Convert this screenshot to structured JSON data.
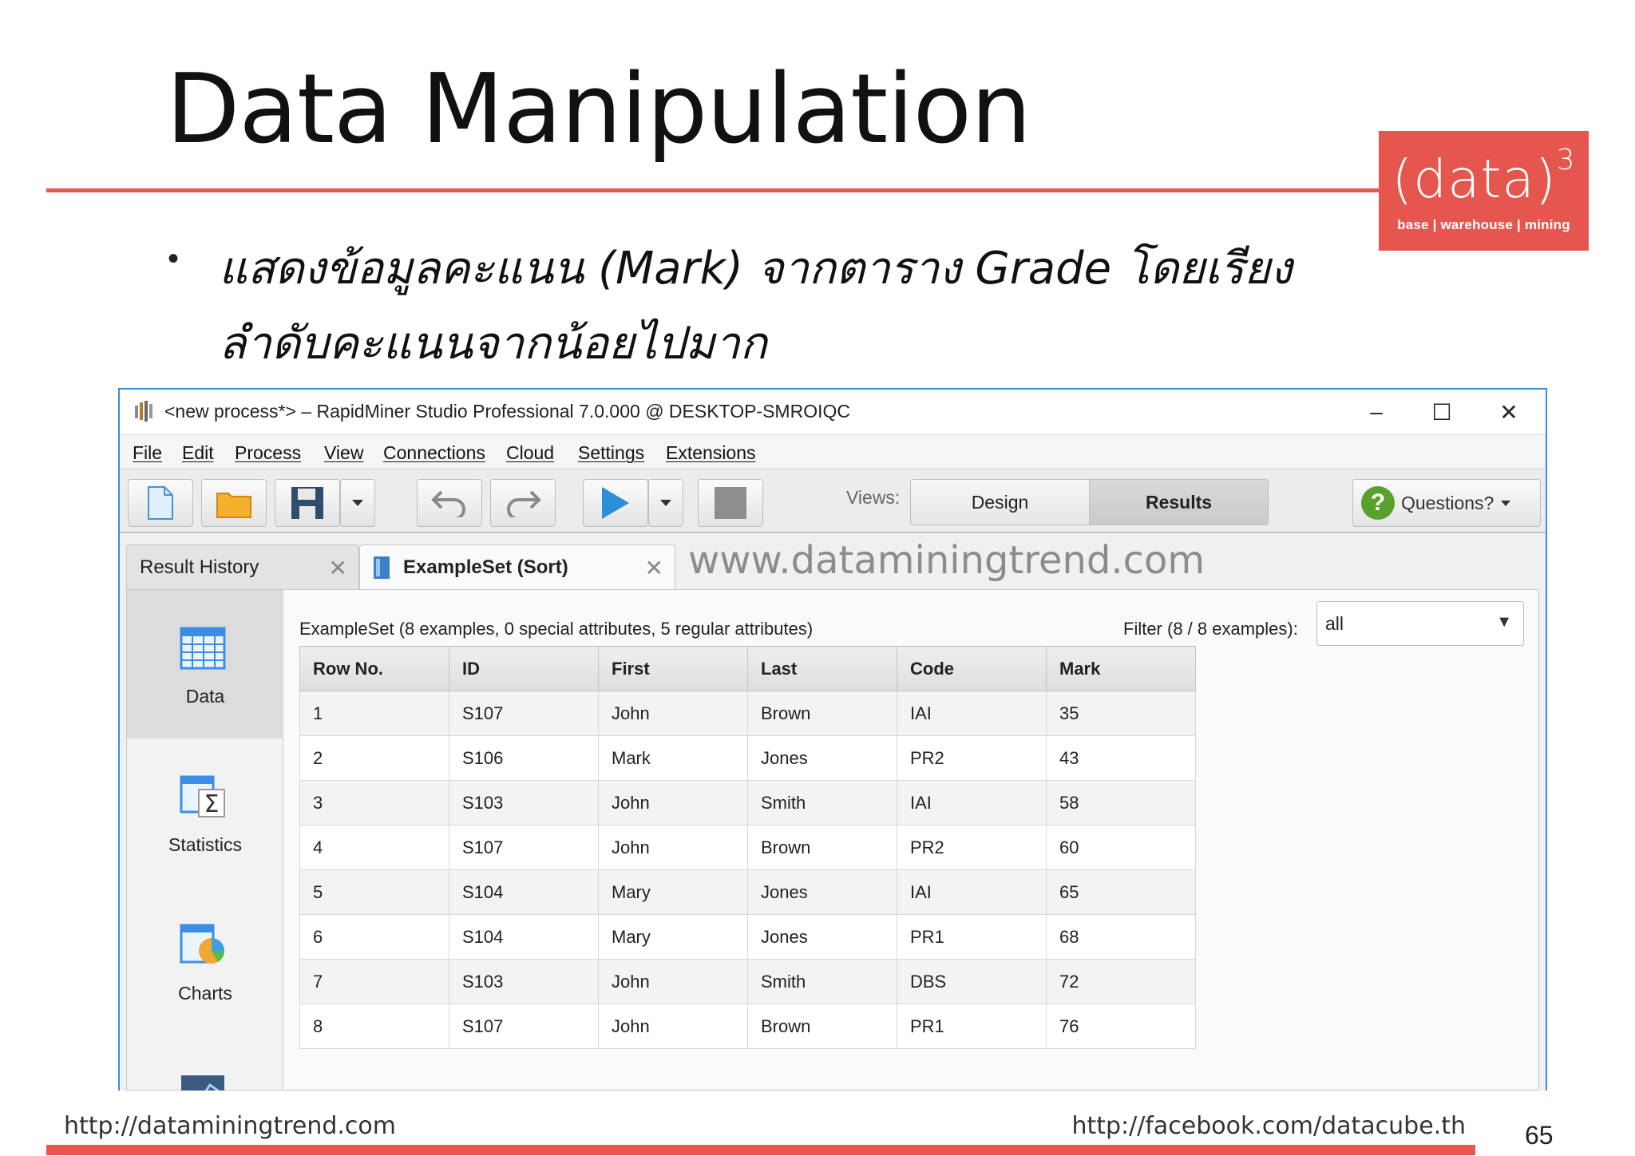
{
  "slide": {
    "title": "Data Manipulation",
    "bullet": "แสดงข้อมูลคะแนน (Mark) จากตาราง Grade โดยเรียงลำดับคะแนนจากน้อยไปมาก",
    "page_number": "65",
    "footer_left": "http://dataminingtrend.com",
    "footer_right": "http://facebook.com/datacube.th",
    "accent_color": "#e5564e"
  },
  "logo": {
    "main": "(data)",
    "superscript": "3",
    "tagline": "base | warehouse | mining"
  },
  "window": {
    "title": "<new process*> – RapidMiner Studio Professional 7.0.000 @ DESKTOP-SMROIQC",
    "controls": {
      "minimize": "–",
      "maximize": "☐",
      "close": "✕"
    }
  },
  "menu": [
    "File",
    "Edit",
    "Process",
    "View",
    "Connections",
    "Cloud",
    "Settings",
    "Extensions"
  ],
  "toolbar": {
    "views_label": "Views:",
    "design_label": "Design",
    "results_label": "Results",
    "questions_label": "Questions?",
    "questions_icon": "?"
  },
  "tabs": {
    "history_label": "Result History",
    "exampleset_label": "ExampleSet (Sort)",
    "close_glyph": "✕"
  },
  "watermark": "www.dataminingtrend.com",
  "sidebar": {
    "items": [
      {
        "label": "Data",
        "icon": "table-icon"
      },
      {
        "label": "Statistics",
        "icon": "sigma-icon"
      },
      {
        "label": "Charts",
        "icon": "chart-icon"
      }
    ]
  },
  "results": {
    "summary": "ExampleSet (8 examples, 0 special attributes, 5 regular attributes)",
    "filter_label": "Filter (8 / 8 examples):",
    "filter_value": "all",
    "columns": [
      "Row No.",
      "ID",
      "First",
      "Last",
      "Code",
      "Mark"
    ],
    "rows": [
      [
        "1",
        "S107",
        "John",
        "Brown",
        "IAI",
        "35"
      ],
      [
        "2",
        "S106",
        "Mark",
        "Jones",
        "PR2",
        "43"
      ],
      [
        "3",
        "S103",
        "John",
        "Smith",
        "IAI",
        "58"
      ],
      [
        "4",
        "S107",
        "John",
        "Brown",
        "PR2",
        "60"
      ],
      [
        "5",
        "S104",
        "Mary",
        "Jones",
        "IAI",
        "65"
      ],
      [
        "6",
        "S104",
        "Mary",
        "Jones",
        "PR1",
        "68"
      ],
      [
        "7",
        "S103",
        "John",
        "Smith",
        "DBS",
        "72"
      ],
      [
        "8",
        "S107",
        "John",
        "Brown",
        "PR1",
        "76"
      ]
    ]
  }
}
